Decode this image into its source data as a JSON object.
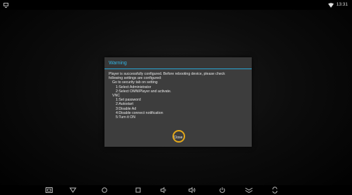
{
  "status_bar": {
    "time": "13:31",
    "icons": [
      "screenshot-icon",
      "wifi-icon"
    ]
  },
  "dialog": {
    "title": "Warning",
    "message_lines": [
      "Player is successfully configured. Before rebooting device, please check",
      "following settings are configured:",
      "Go to security tab on setting",
      "1:Select Administrator",
      "2:Select OMNIPlayer and activate.",
      "VNC",
      "1:Set password",
      "2:Autostart",
      "3:Disable Ad",
      "4:Disable connect notification",
      "5:Turn it ON"
    ],
    "close_label": "Close"
  },
  "nav_bar": {
    "buttons": [
      "screencap-icon",
      "back-icon",
      "home-icon",
      "recent-apps-icon",
      "volume-down-icon",
      "volume-up-icon",
      "power-icon",
      "collapse-icon",
      "rotate-icon"
    ]
  },
  "colors": {
    "accent": "#33b5e5",
    "dialog_bg": "#3d3d3d",
    "highlight_ring": "#e3a81a"
  }
}
